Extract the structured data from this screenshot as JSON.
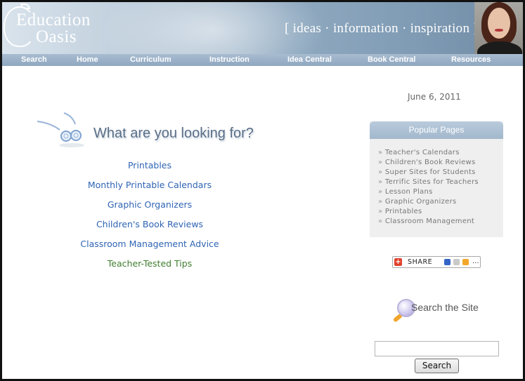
{
  "header": {
    "logo_line1": "Education",
    "logo_line2": "Oasis",
    "tagline": "[ ideas · information · inspiration ]"
  },
  "nav": {
    "items": [
      "Search",
      "Home",
      "Curriculum",
      "Instruction",
      "Idea Central",
      "Book Central",
      "Resources"
    ]
  },
  "date": "June 6, 2011",
  "main": {
    "heading": "What are you looking for?",
    "links": [
      "Printables",
      "Monthly Printable Calendars",
      "Graphic Organizers",
      "Children's Book Reviews",
      "Classroom Management Advice",
      "Teacher-Tested Tips"
    ]
  },
  "popular": {
    "title": "Popular Pages",
    "bullet": "»",
    "items": [
      "Teacher's Calendars",
      "Children's Book Reviews",
      "Super Sites for Students",
      "Terrific Sites for Teachers",
      "Lesson Plans",
      "Graphic Organizers",
      "Printables",
      "Classroom Management"
    ]
  },
  "share": {
    "label": "SHARE",
    "more": "..."
  },
  "search": {
    "title": "Search the Site",
    "input_value": "",
    "button_label": "Search"
  },
  "colors": {
    "link_blue": "#2f64b4",
    "link_green": "#3f7d2e",
    "nav_bar": "#8ea7c0",
    "heading": "#5a6f88"
  }
}
